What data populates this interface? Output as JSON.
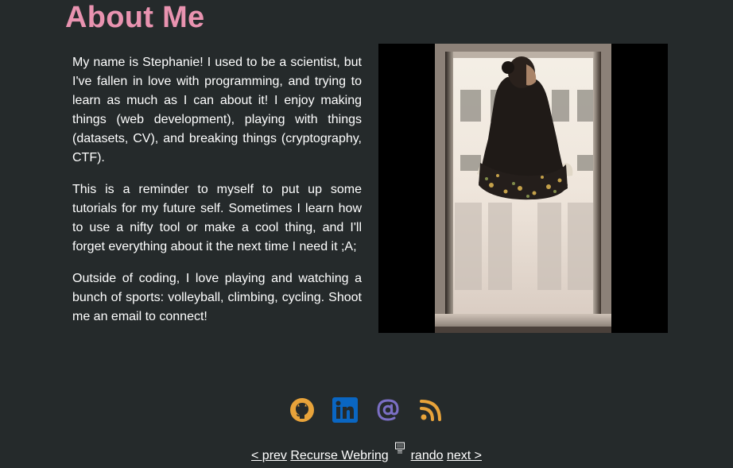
{
  "page": {
    "title": "About Me"
  },
  "bio": {
    "paragraphs": [
      "My name is Stephanie! I used to be a scientist, but I've fallen in love with programming, and trying to learn as much as I can about it! I enjoy making things (web development), playing with things (datasets, CV), and breaking things (cryptography, CTF).",
      "This is a reminder to myself to put up some tutorials for my future self. Sometimes I learn how to use a nifty tool or make a cool thing, and I'll forget everything about it the next time I need it ;A;",
      "Outside of coding, I love playing and watching a bunch of sports: volleyball, climbing, cycling. Shoot me an email to connect!"
    ]
  },
  "photo": {
    "subject": "woman in dark floral jacket sitting in a window frame"
  },
  "social": {
    "icons": [
      {
        "name": "github-icon",
        "color": "#e8a33a"
      },
      {
        "name": "linkedin-icon",
        "color": "#0a66c2"
      },
      {
        "name": "email-at-icon",
        "color": "#7b6fc4"
      },
      {
        "name": "rss-icon",
        "color": "#e8a33a"
      }
    ]
  },
  "webring": {
    "prev_label": "< prev",
    "name_label": "Recurse Webring",
    "rando_label": "rando",
    "next_label": "next >"
  },
  "colors": {
    "background": "#252a2b",
    "title": "#e993b0",
    "text": "#ffffff"
  }
}
